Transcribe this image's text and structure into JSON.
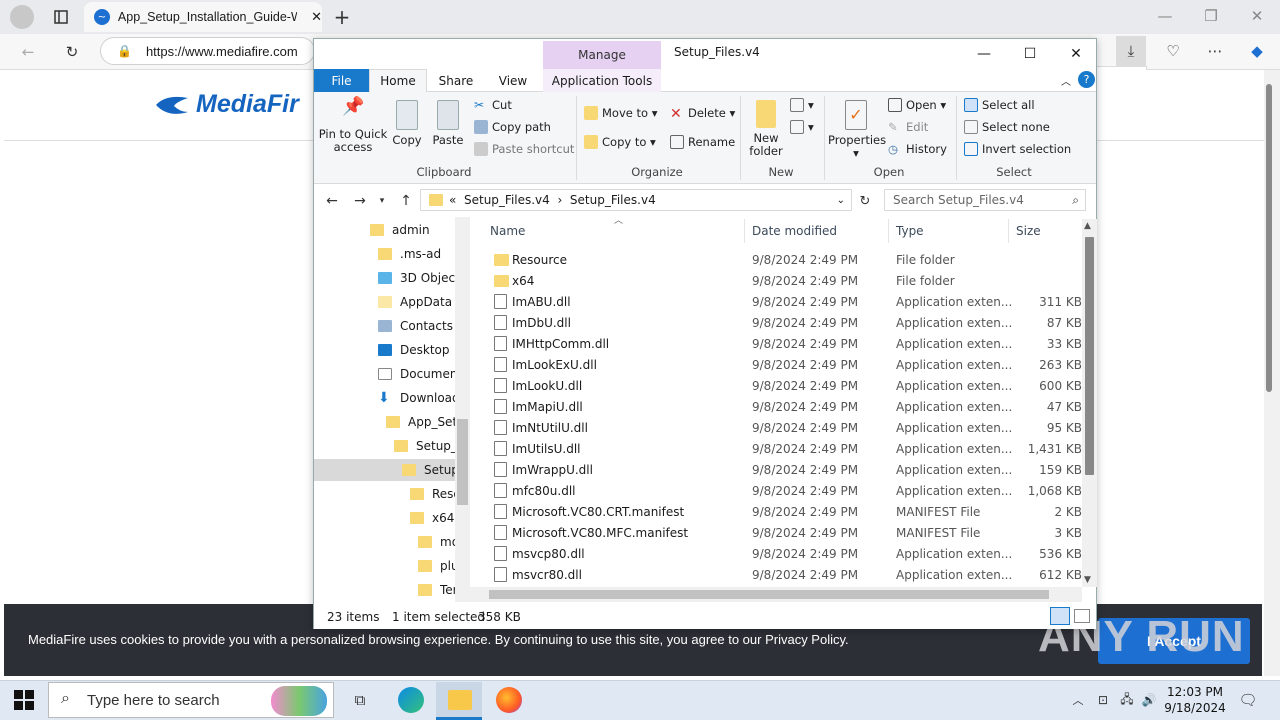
{
  "browser": {
    "tab_title": "App_Setup_Installation_Guide-W",
    "url": "https://www.mediafire.com"
  },
  "page": {
    "logo_text": "MediaFir",
    "cookie_text": "MediaFire uses cookies to provide you with a personalized browsing experience. By continuing to use this site, you agree to our Privacy Policy.",
    "accept_label": "I Accept",
    "watermark": "ANY RUN"
  },
  "explorer": {
    "manage_label": "Manage",
    "title": "Setup_Files.v4",
    "tabs": {
      "file": "File",
      "home": "Home",
      "share": "Share",
      "view": "View",
      "app_tools": "Application Tools"
    },
    "ribbon": {
      "pin": "Pin to Quick access",
      "copy": "Copy",
      "paste": "Paste",
      "cut": "Cut",
      "copy_path": "Copy path",
      "paste_shortcut": "Paste shortcut",
      "clipboard": "Clipboard",
      "move_to": "Move to",
      "copy_to": "Copy to",
      "delete": "Delete",
      "rename": "Rename",
      "organize": "Organize",
      "new_folder": "New folder",
      "new": "New",
      "properties": "Properties",
      "open_btn": "Open",
      "edit": "Edit",
      "history": "History",
      "open_group": "Open",
      "select_all": "Select all",
      "select_none": "Select none",
      "invert": "Invert selection",
      "select_group": "Select"
    },
    "path": {
      "prefix": "«",
      "part1": "Setup_Files.v4",
      "sep": "›",
      "part2": "Setup_Files.v4"
    },
    "search_placeholder": "Search Setup_Files.v4",
    "tree": [
      "admin",
      ".ms-ad",
      "3D Objects",
      "AppData",
      "Contacts",
      "Desktop",
      "Documents",
      "Downloads",
      "App_Setup",
      "Setup_F",
      "Setup",
      "Reso",
      "x64",
      "mo",
      "plu",
      "Ter"
    ],
    "headers": {
      "name": "Name",
      "date": "Date modified",
      "type": "Type",
      "size": "Size"
    },
    "files": [
      {
        "name": "Resource",
        "date": "9/8/2024 2:49 PM",
        "type": "File folder",
        "size": "",
        "kind": "folder"
      },
      {
        "name": "x64",
        "date": "9/8/2024 2:49 PM",
        "type": "File folder",
        "size": "",
        "kind": "folder"
      },
      {
        "name": "ImABU.dll",
        "date": "9/8/2024 2:49 PM",
        "type": "Application exten...",
        "size": "311 KB",
        "kind": "dll"
      },
      {
        "name": "ImDbU.dll",
        "date": "9/8/2024 2:49 PM",
        "type": "Application exten...",
        "size": "87 KB",
        "kind": "dll"
      },
      {
        "name": "IMHttpComm.dll",
        "date": "9/8/2024 2:49 PM",
        "type": "Application exten...",
        "size": "33 KB",
        "kind": "dll"
      },
      {
        "name": "ImLookExU.dll",
        "date": "9/8/2024 2:49 PM",
        "type": "Application exten...",
        "size": "263 KB",
        "kind": "dll"
      },
      {
        "name": "ImLookU.dll",
        "date": "9/8/2024 2:49 PM",
        "type": "Application exten...",
        "size": "600 KB",
        "kind": "dll"
      },
      {
        "name": "ImMapiU.dll",
        "date": "9/8/2024 2:49 PM",
        "type": "Application exten...",
        "size": "47 KB",
        "kind": "dll"
      },
      {
        "name": "ImNtUtilU.dll",
        "date": "9/8/2024 2:49 PM",
        "type": "Application exten...",
        "size": "95 KB",
        "kind": "dll"
      },
      {
        "name": "ImUtilsU.dll",
        "date": "9/8/2024 2:49 PM",
        "type": "Application exten...",
        "size": "1,431 KB",
        "kind": "dll"
      },
      {
        "name": "ImWrappU.dll",
        "date": "9/8/2024 2:49 PM",
        "type": "Application exten...",
        "size": "159 KB",
        "kind": "dll"
      },
      {
        "name": "mfc80u.dll",
        "date": "9/8/2024 2:49 PM",
        "type": "Application exten...",
        "size": "1,068 KB",
        "kind": "dll"
      },
      {
        "name": "Microsoft.VC80.CRT.manifest",
        "date": "9/8/2024 2:49 PM",
        "type": "MANIFEST File",
        "size": "2 KB",
        "kind": "manifest"
      },
      {
        "name": "Microsoft.VC80.MFC.manifest",
        "date": "9/8/2024 2:49 PM",
        "type": "MANIFEST File",
        "size": "3 KB",
        "kind": "manifest"
      },
      {
        "name": "msvcp80.dll",
        "date": "9/8/2024 2:49 PM",
        "type": "Application exten...",
        "size": "536 KB",
        "kind": "dll"
      },
      {
        "name": "msvcr80.dll",
        "date": "9/8/2024 2:49 PM",
        "type": "Application exten...",
        "size": "612 KB",
        "kind": "dll"
      }
    ],
    "status": {
      "count": "23 items",
      "selected": "1 item selected",
      "size": "358 KB"
    }
  },
  "taskbar": {
    "search_placeholder": "Type here to search",
    "time": "12:03 PM",
    "date": "9/18/2024"
  }
}
